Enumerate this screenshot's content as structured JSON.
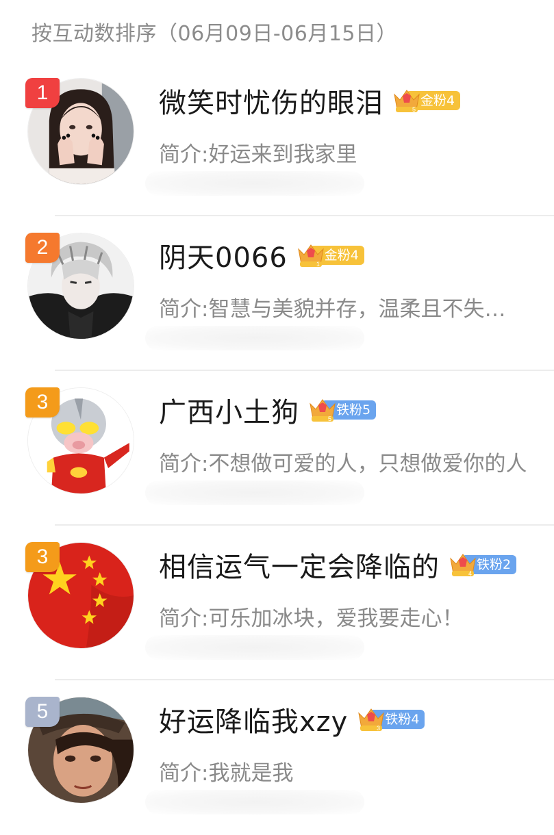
{
  "header": {
    "title": "按互动数排序（06月09日-06月15日）"
  },
  "colors": {
    "gold_pill": "#f7c23a",
    "iron_pill": "#6aa4ee",
    "rank_1": "#f04040",
    "rank_2": "#f5792e",
    "rank_3": "#f49b1a",
    "rank_5": "#a9b4cc",
    "bio_text": "#8a8a8a",
    "header_text": "#8c8c8c"
  },
  "fans": [
    {
      "rank": "1",
      "name": "微笑时忧伤的眼泪",
      "crown_level": "5",
      "badge": "金粉4",
      "badge_type": "gold",
      "bio": "简介:好运来到我家里",
      "avatar_icon": "girl-avatar-icon"
    },
    {
      "rank": "2",
      "name": "阴天0066",
      "crown_level": "1",
      "badge": "金粉4",
      "badge_type": "gold",
      "bio": "简介:智慧与美貌并存，温柔且不失…",
      "avatar_icon": "anime-boy-avatar-icon"
    },
    {
      "rank": "3",
      "name": "广西小土狗",
      "crown_level": "5",
      "badge": "铁粉5",
      "badge_type": "iron",
      "bio": "简介:不想做可爱的人，只想做爱你的人",
      "avatar_icon": "pig-hero-avatar-icon"
    },
    {
      "rank": "3",
      "name": "相信运气一定会降临的",
      "crown_level": "4",
      "badge": "铁粉2",
      "badge_type": "iron",
      "bio": "简介:可乐加冰块，爱我要走心！",
      "avatar_icon": "china-flag-avatar-icon"
    },
    {
      "rank": "5",
      "name": "好运降临我xzy",
      "crown_level": "3",
      "badge": "铁粉4",
      "badge_type": "iron",
      "bio": "简介:我就是我",
      "avatar_icon": "warrior-avatar-icon"
    }
  ]
}
